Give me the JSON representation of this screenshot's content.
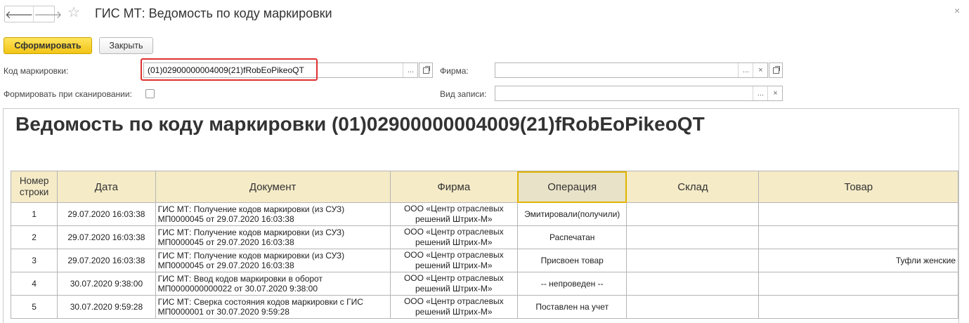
{
  "window": {
    "title": "ГИС МТ: Ведомость по коду маркировки",
    "close_glyph": "×"
  },
  "nav": {
    "back": "🡐",
    "forward": "🡒",
    "star": "☆"
  },
  "toolbar": {
    "generate_label": "Сформировать",
    "close_label": "Закрыть"
  },
  "form": {
    "code_label": "Код маркировки:",
    "code_value": "(01)02900000004009(21)fRobEoPikeoQT",
    "firm_label": "Фирма:",
    "firm_value": "",
    "scan_label": "Формировать при сканировании:",
    "record_type_label": "Вид записи:",
    "record_type_value": "",
    "select_glyph": "...",
    "clear_glyph": "×"
  },
  "report": {
    "title": "Ведомость по коду маркировки (01)02900000004009(21)fRobEoPikeoQT",
    "columns": [
      "Номер строки",
      "Дата",
      "Документ",
      "Фирма",
      "Операция",
      "Склад",
      "Товар"
    ],
    "rows": [
      {
        "num": "1",
        "date": "29.07.2020 16:03:38",
        "doc1": "ГИС МТ: Получение кодов маркировки (из СУЗ)",
        "doc2": "МП0000045 от 29.07.2020 16:03:38",
        "firm1": "ООО «Центр отраслевых",
        "firm2": "решений Штрих-М»",
        "operation": "Эмитировали(получили)",
        "warehouse": "",
        "product": ""
      },
      {
        "num": "2",
        "date": "29.07.2020 16:03:38",
        "doc1": "ГИС МТ: Получение кодов маркировки (из СУЗ)",
        "doc2": "МП0000045 от 29.07.2020 16:03:38",
        "firm1": "ООО «Центр отраслевых",
        "firm2": "решений Штрих-М»",
        "operation": "Распечатан",
        "warehouse": "",
        "product": ""
      },
      {
        "num": "3",
        "date": "29.07.2020 16:03:38",
        "doc1": "ГИС МТ: Получение кодов маркировки (из СУЗ)",
        "doc2": "МП0000045 от 29.07.2020 16:03:38",
        "firm1": "ООО «Центр отраслевых",
        "firm2": "решений Штрих-М»",
        "operation": "Присвоен товар",
        "warehouse": "",
        "product": "Туфли женские"
      },
      {
        "num": "4",
        "date": "30.07.2020 9:38:00",
        "doc1": "ГИС МТ: Ввод кодов маркировки в оборот",
        "doc2": "МП0000000000022 от 30.07.2020 9:38:00",
        "firm1": "ООО «Центр отраслевых",
        "firm2": "решений Штрих-М»",
        "operation": "-- непроведен --",
        "warehouse": "",
        "product": ""
      },
      {
        "num": "5",
        "date": "30.07.2020 9:59:28",
        "doc1": "ГИС МТ: Сверка состояния кодов маркировки с ГИС",
        "doc2": "МП0000001 от 30.07.2020 9:59:28",
        "firm1": "ООО «Центр отраслевых",
        "firm2": "решений Штрих-М»",
        "operation": "Поставлен на учет",
        "warehouse": "",
        "product": ""
      }
    ]
  }
}
